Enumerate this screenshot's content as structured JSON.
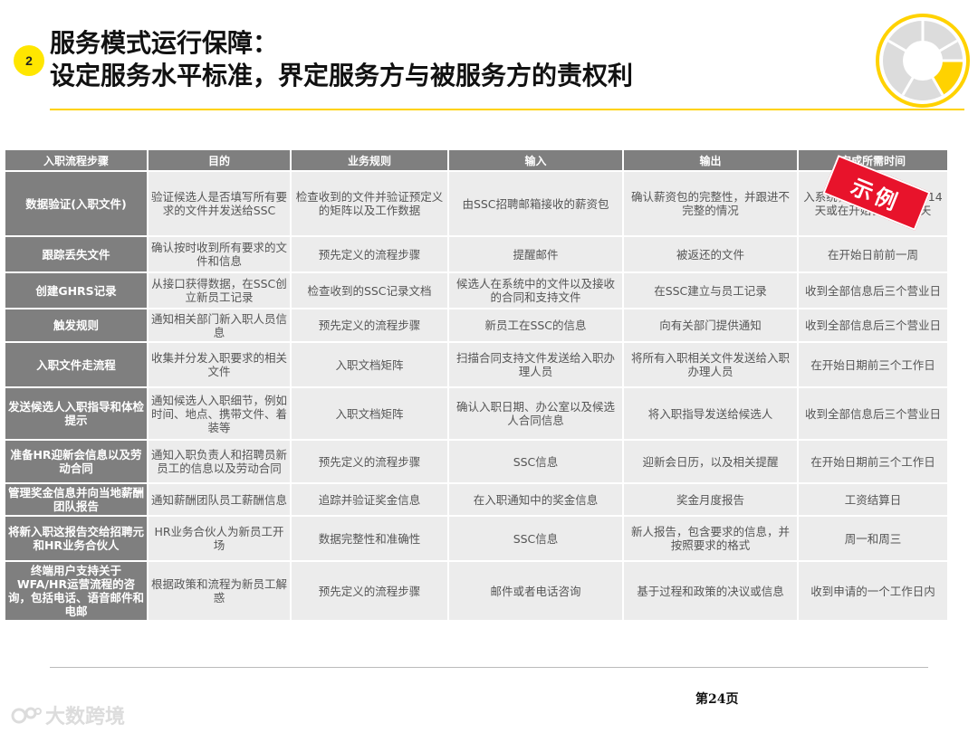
{
  "header": {
    "badge": "2",
    "title_line1": "服务模式运行保障：",
    "title_line2": "设定服务水平标准，界定服务方与被服务方的责权利"
  },
  "table": {
    "columns": [
      "入职流程步骤",
      "目的",
      "业务规则",
      "输入",
      "输出",
      "完成所需时间"
    ],
    "rows": [
      [
        "数据验证(入职文件)",
        "验证候选人是否填写所有要求的文件并发送给SSC",
        "检查收到的文件并验证预定义的矩阵以及工作数据",
        "由SSC招聘邮箱接收的薪资包",
        "确认薪资包的完整性，并跟进不完整的情况",
        "入系统，在聘开始日期前14天或在开始日期前30天"
      ],
      [
        "跟踪丢失文件",
        "确认按时收到所有要求的文件和信息",
        "预先定义的流程步骤",
        "提醒邮件",
        "被返还的文件",
        "在开始日前前一周"
      ],
      [
        "创建GHRS记录",
        "从接口获得数据，在SSC创立新员工记录",
        "检查收到的SSC记录文档",
        "候选人在系统中的文件以及接收的合同和支持文件",
        "在SSC建立与员工记录",
        "收到全部信息后三个营业日"
      ],
      [
        "触发规则",
        "通知相关部门新入职人员信息",
        "预先定义的流程步骤",
        "新员工在SSC的信息",
        "向有关部门提供通知",
        "收到全部信息后三个营业日"
      ],
      [
        "入职文件走流程",
        "收集并分发入职要求的相关文件",
        "入职文档矩阵",
        "扫描合同支持文件发送给入职办理人员",
        "将所有入职相关文件发送给入职办理人员",
        "在开始日期前三个工作日"
      ],
      [
        "发送候选人入职指导和体检提示",
        "通知候选人入职细节，例如时间、地点、携带文件、着装等",
        "入职文档矩阵",
        "确认入职日期、办公室以及候选人合同信息",
        "将入职指导发送给候选人",
        "收到全部信息后三个营业日"
      ],
      [
        "准备HR迎新会信息以及劳动合同",
        "通知入职负责人和招聘员新员工的信息以及劳动合同",
        "预先定义的流程步骤",
        "SSC信息",
        "迎新会日历，以及相关提醒",
        "在开始日期前三个工作日"
      ],
      [
        "管理奖金信息并向当地薪酬团队报告",
        "通知薪酬团队员工薪酬信息",
        "追踪并验证奖金信息",
        "在入职通知中的奖金信息",
        "奖金月度报告",
        "工资结算日"
      ],
      [
        "将新入职这报告交给招聘元和HR业务合伙人",
        "HR业务合伙人为新员工开场",
        "数据完整性和准确性",
        "SSC信息",
        "新人报告，包含要求的信息，并按照要求的格式",
        "周一和周三"
      ],
      [
        "终端用户支持关于WFA/HR运营流程的咨询，包括电话、语音邮件和电邮",
        "根据政策和流程为新员工解惑",
        "预先定义的流程步骤",
        "邮件或者电话咨询",
        "基于过程和政策的决议或信息",
        "收到申请的一个工作日内"
      ]
    ]
  },
  "stamp": "示例",
  "footer": {
    "page": "第24页",
    "watermark": "大数跨境"
  },
  "colors": {
    "accent_yellow": "#ffe600",
    "header_gray": "#7f7f7f",
    "cell_gray": "#ececec",
    "stamp_red": "#e8132b"
  }
}
